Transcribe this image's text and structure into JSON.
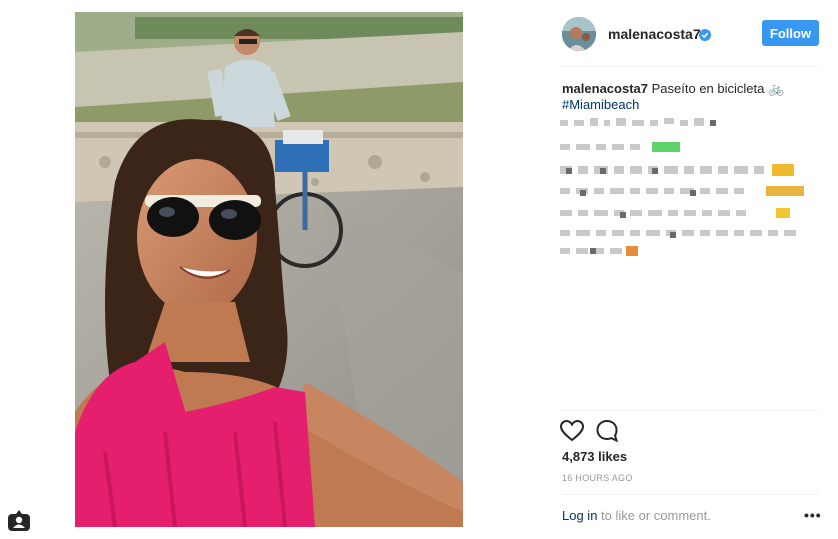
{
  "post": {
    "username": "malenacosta7",
    "follow_label": "Follow",
    "caption_user": "malenacosta7",
    "caption_text": "Paseíto en bicicleta 🚲",
    "hashtag": "#Miamibeach",
    "likes": "4,873 likes",
    "timestamp": "16 HOURS AGO",
    "login_link": "Log in",
    "login_suffix": " to like or comment.",
    "more_label": "•••"
  },
  "colors": {
    "accent": "#3897f0",
    "link": "#003569",
    "muted": "#999999",
    "divider": "#efefef"
  },
  "icons": {
    "verified": "verified-badge-icon",
    "like": "heart-outline-icon",
    "comment": "comment-bubble-icon",
    "photo_badge": "user-tag-icon"
  }
}
